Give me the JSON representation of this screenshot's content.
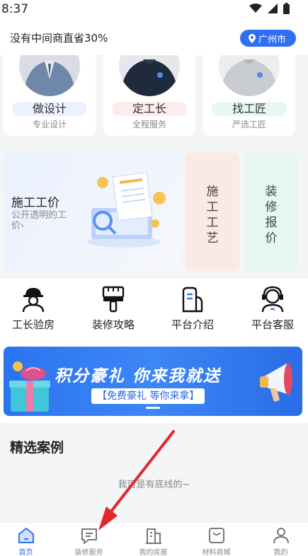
{
  "status_bar": {
    "time": "8:37",
    "icons": [
      "wifi-icon",
      "signal-icon",
      "battery-icon"
    ]
  },
  "header": {
    "slogan": "没有中间商直省30%",
    "city": "广州市",
    "city_icon": "location-pin-icon"
  },
  "services": [
    {
      "tag": "做设计",
      "sub": "专业设计",
      "tag_color": "#eaf1ff"
    },
    {
      "tag": "定工长",
      "sub": "全程服务",
      "tag_color": "#fdecec"
    },
    {
      "tag": "找工匠",
      "sub": "严选工匠",
      "tag_color": "#e7f7f3"
    }
  ],
  "price_card": {
    "title": "施工工价",
    "subtitle": "公开透明的工价",
    "chevron": "›"
  },
  "vertical_cards": [
    {
      "chars": [
        "施",
        "工",
        "工",
        "艺"
      ],
      "color": "#fbe9e4"
    },
    {
      "chars": [
        "装",
        "修",
        "报",
        "价"
      ],
      "color": "#e6f6f2"
    }
  ],
  "quick_links": [
    {
      "label": "工长验房",
      "icon": "foreman-icon"
    },
    {
      "label": "装修攻略",
      "icon": "paintbrush-icon"
    },
    {
      "label": "平台介绍",
      "icon": "platform-icon"
    },
    {
      "label": "平台客服",
      "icon": "customer-service-icon"
    }
  ],
  "banner": {
    "title": "积分豪礼 你来我就送",
    "subtitle": "【免费豪礼 等你来拿】"
  },
  "cases": {
    "title": "精选案例",
    "end_text": "我可是有底线的~"
  },
  "tabs": [
    {
      "label": "首页",
      "icon": "home-icon",
      "active": true
    },
    {
      "label": "装修服务",
      "icon": "message-icon",
      "active": false
    },
    {
      "label": "我的房屋",
      "icon": "building-icon",
      "active": false
    },
    {
      "label": "材料商城",
      "icon": "shopping-bag-icon",
      "active": false
    },
    {
      "label": "我的",
      "icon": "user-icon",
      "active": false
    }
  ],
  "colors": {
    "accent": "#2f6ef5",
    "annotation": "#e3262b"
  }
}
